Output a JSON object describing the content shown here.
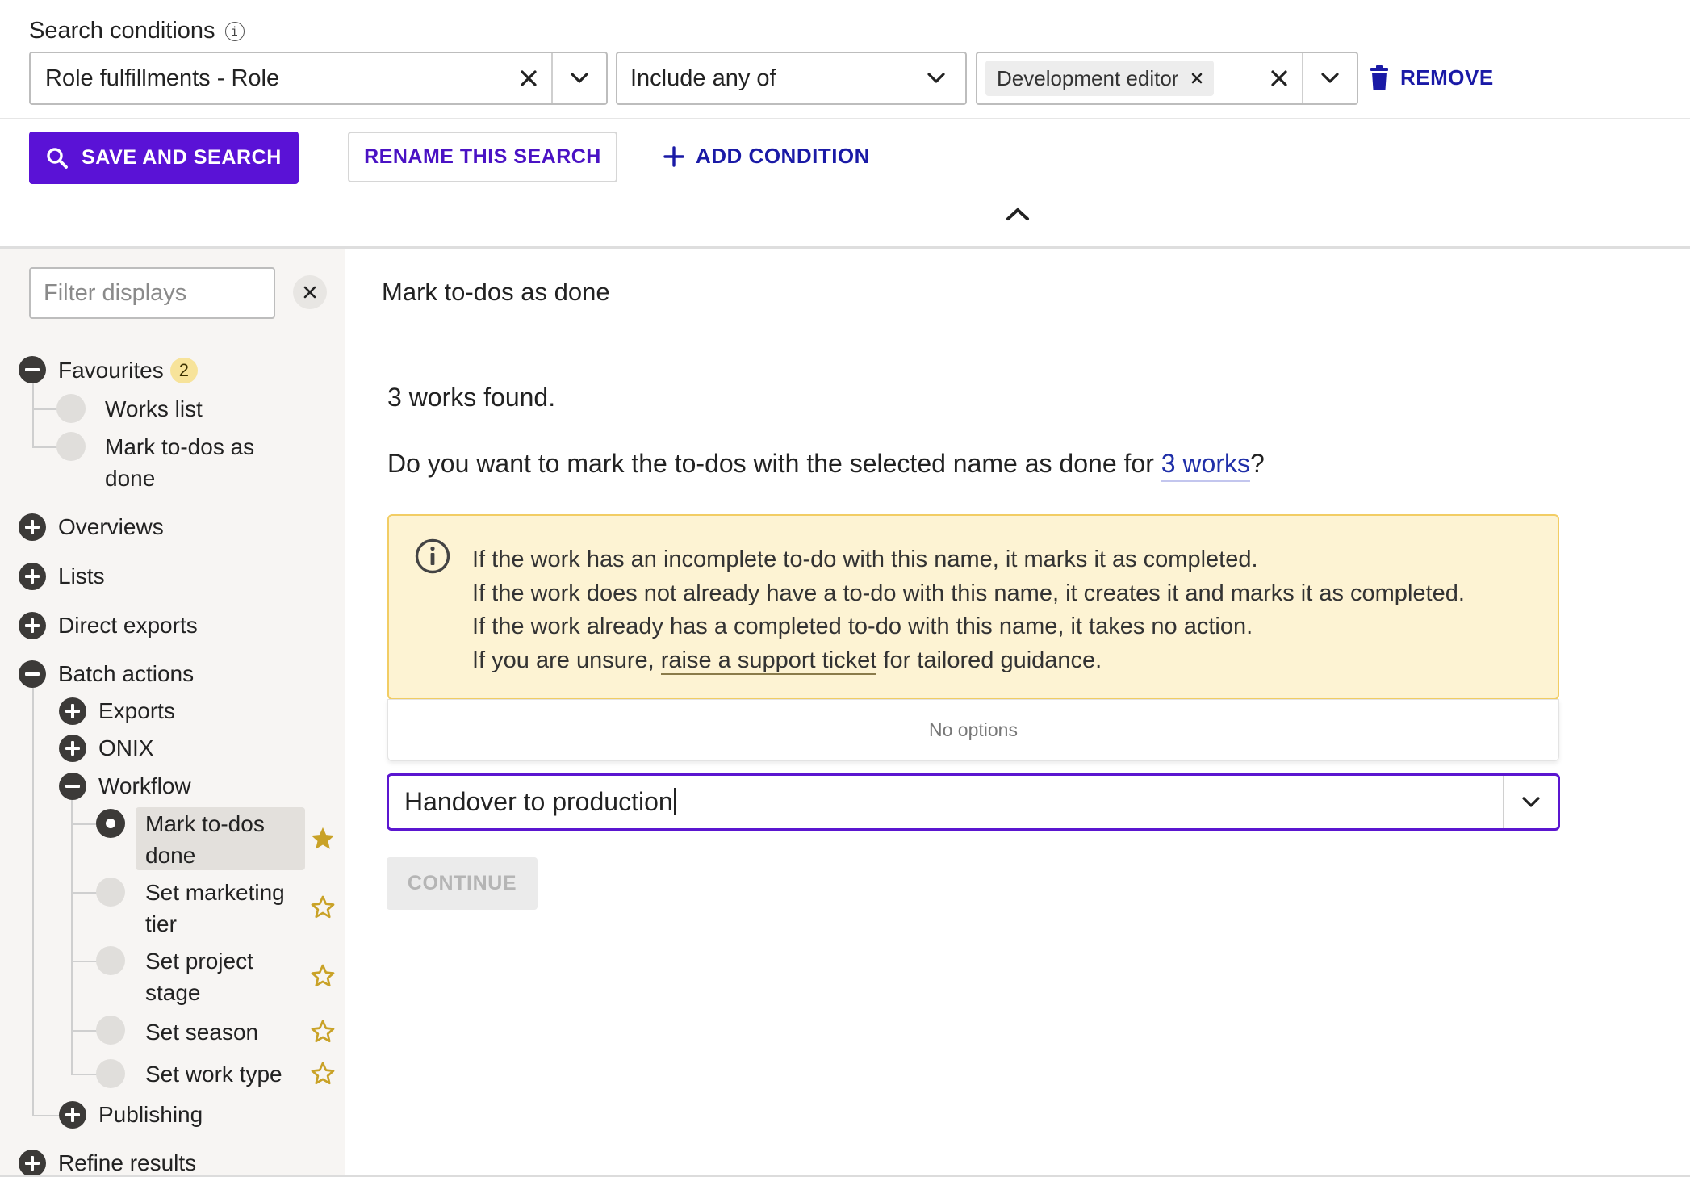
{
  "search": {
    "label": "Search conditions",
    "info_glyph": "i",
    "field_value": "Role fulfillments - Role",
    "operator_value": "Include any of",
    "value_chip": "Development editor",
    "remove_label": "REMOVE",
    "save_label": "SAVE AND SEARCH",
    "rename_label": "RENAME THIS SEARCH",
    "add_label": "ADD CONDITION"
  },
  "sidebar": {
    "filter_placeholder": "Filter displays",
    "favourites": {
      "label": "Favourites",
      "count": "2"
    },
    "fav_items": [
      "Works list",
      "Mark to-dos as done"
    ],
    "overviews": "Overviews",
    "lists": "Lists",
    "direct_exports": "Direct exports",
    "batch_actions": "Batch actions",
    "exports": "Exports",
    "onix": "ONIX",
    "workflow": "Workflow",
    "workflow_items": [
      "Mark to-dos done",
      "Set marketing tier",
      "Set project stage",
      "Set season",
      "Set work type"
    ],
    "publishing": "Publishing",
    "refine_results": "Refine results"
  },
  "main": {
    "title": "Mark to-dos as done",
    "works_found": "3 works found.",
    "question_before": "Do you want to mark the to-dos with the selected name as done for ",
    "question_link": "3 works",
    "question_after": "?",
    "notice": {
      "line1": "If the work has an incomplete to-do with this name, it marks it as completed.",
      "line2": "If the work does not already have a to-do with this name, it creates it and marks it as completed.",
      "line3": "If the work already has a completed to-do with this name, it takes no action.",
      "line4_before": "If you are unsure, ",
      "line4_link": "raise a support ticket",
      "line4_after": " for tailored guidance."
    },
    "no_options": "No options",
    "todo_input_value": "Handover to production",
    "continue_label": "CONTINUE"
  },
  "colors": {
    "primary": "#5a12d6",
    "link": "#1a1aa6",
    "notice_bg": "#fdf3d3",
    "notice_border": "#f2cd64",
    "star": "#c9a227",
    "sidebar_bg": "#f7f5f3"
  },
  "icons": {
    "search": "magnifier-icon",
    "remove": "trash-icon",
    "add": "plus-icon",
    "collapse": "chevron-up-icon",
    "star_filled": "star-filled-icon",
    "star_outline": "star-outline-icon"
  }
}
